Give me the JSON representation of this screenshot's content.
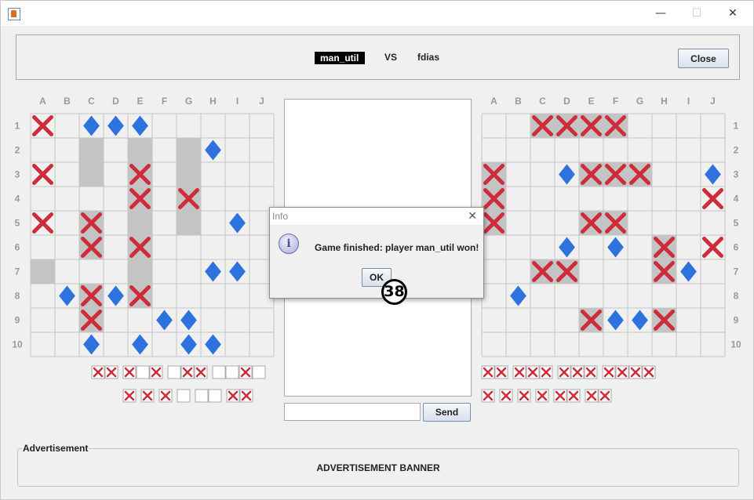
{
  "window": {
    "minimize_glyph": "—",
    "maximize_glyph": "☐",
    "close_glyph": "✕"
  },
  "header": {
    "player1": "man_util",
    "vs_label": "VS",
    "player2": "fdias",
    "close_button": "Close"
  },
  "boards": {
    "columns": [
      "A",
      "B",
      "C",
      "D",
      "E",
      "F",
      "G",
      "H",
      "I",
      "J"
    ],
    "rows": [
      "1",
      "2",
      "3",
      "4",
      "5",
      "6",
      "7",
      "8",
      "9",
      "10"
    ],
    "colors": {
      "ship": "#c4c4c4",
      "hit": "#cd2d3a",
      "miss": "#2e72dd",
      "grid": "#c4c4c4",
      "cell": "#f0f0f0"
    },
    "left": {
      "ships": [
        "C2",
        "C3",
        "E2",
        "E3",
        "E4",
        "E5",
        "E6",
        "E7",
        "E8",
        "G2",
        "G3",
        "G4",
        "G5",
        "A7",
        "C5",
        "C6",
        "C8",
        "C9",
        "E8",
        "G4"
      ],
      "hits": [
        "A1",
        "A3",
        "A5",
        "C5",
        "C6",
        "C8",
        "C9",
        "E3",
        "E4",
        "E6",
        "E8",
        "G4"
      ],
      "misses": [
        "C1",
        "D1",
        "E1",
        "H2",
        "I5",
        "H7",
        "I7",
        "B8",
        "D8",
        "F9",
        "G9",
        "C10",
        "E10",
        "G10",
        "H10"
      ]
    },
    "right": {
      "ships": [
        "C1",
        "D1",
        "E1",
        "F1",
        "A3",
        "E3",
        "F3",
        "G3",
        "A4",
        "A5",
        "E5",
        "F5",
        "H6",
        "C7",
        "D7",
        "H7",
        "E9",
        "H9"
      ],
      "hits": [
        "C1",
        "D1",
        "E1",
        "F1",
        "A3",
        "E3",
        "F3",
        "G3",
        "J4",
        "A4",
        "A5",
        "E5",
        "F5",
        "H6",
        "J6",
        "C7",
        "D7",
        "H7",
        "E9",
        "H9"
      ],
      "misses": [
        "D3",
        "J3",
        "D6",
        "F6",
        "I7",
        "B8",
        "F9",
        "G9"
      ]
    }
  },
  "fleet": {
    "left_row1": [
      "X",
      "X",
      "sp",
      "X",
      "_",
      "X",
      "sp",
      "_",
      "X",
      "X",
      "sp",
      "_",
      "_",
      "X",
      "_"
    ],
    "left_row2": [
      "X",
      "sp",
      "X",
      "sp",
      "X",
      "sp",
      "_",
      "sp",
      "_",
      "_",
      "sp",
      "X",
      "X"
    ],
    "right_row1": [
      "X",
      "X",
      "sp",
      "X",
      "X",
      "X",
      "sp",
      "X",
      "X",
      "X",
      "sp",
      "X",
      "X",
      "X",
      "X"
    ],
    "right_row2": [
      "X",
      "sp",
      "X",
      "sp",
      "X",
      "sp",
      "X",
      "sp",
      "X",
      "X",
      "sp",
      "X",
      "X"
    ]
  },
  "chat": {
    "send_button": "Send",
    "input_value": ""
  },
  "advertisement": {
    "legend": "Advertisement",
    "banner": "ADVERTISEMENT BANNER"
  },
  "dialog": {
    "title": "Info",
    "message": "Game finished: player man_util won!",
    "ok_button": "OK",
    "icon": "info-icon"
  },
  "annotation": {
    "badge": "38"
  }
}
